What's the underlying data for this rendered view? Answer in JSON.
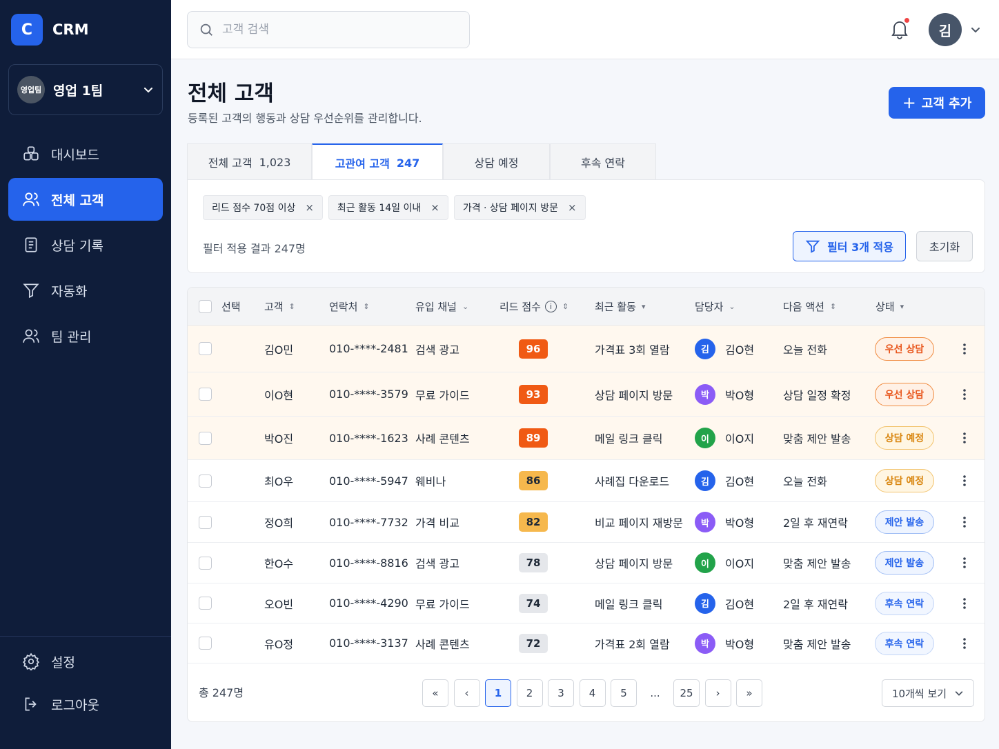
{
  "brand": {
    "logo": "C",
    "name": "CRM"
  },
  "team": {
    "avatar": "영업팀",
    "name": "영업 1팀"
  },
  "nav": [
    {
      "label": "대시보드",
      "icon": "dashboard-icon"
    },
    {
      "label": "전체 고객",
      "icon": "users-icon",
      "active": true
    },
    {
      "label": "상담 기록",
      "icon": "document-icon"
    },
    {
      "label": "자동화",
      "icon": "filter-icon"
    },
    {
      "label": "팀 관리",
      "icon": "team-icon"
    }
  ],
  "nav_bottom": [
    {
      "label": "설정",
      "icon": "gear-icon"
    },
    {
      "label": "로그아웃",
      "icon": "logout-icon"
    }
  ],
  "search": {
    "placeholder": "고객 검색",
    "value": ""
  },
  "user": {
    "avatar": "김"
  },
  "header": {
    "title": "전체 고객",
    "subtitle": "등록된 고객의 행동과 상담 우선순위를 관리합니다.",
    "add_label": "고객 추가"
  },
  "tabs": [
    {
      "label": "전체 고객",
      "count": "1,023",
      "width": 181
    },
    {
      "label": "고관여 고객",
      "count": "247",
      "active": true,
      "width": 190
    },
    {
      "label": "상담 예정",
      "count": "",
      "width": 155
    },
    {
      "label": "후속 연락",
      "count": "",
      "width": 154
    }
  ],
  "filters": {
    "chips": [
      "리드 점수 70점 이상",
      "최근 활동 14일 이내",
      "가격 · 상담 페이지 방문"
    ],
    "result_text": "필터 적용 결과 247명",
    "apply_label": "필터 3개 적용",
    "reset_label": "초기화"
  },
  "table": {
    "columns": {
      "select": "선택",
      "customer": "고객",
      "contact": "연락처",
      "channel": "유입 채널",
      "score": "리드 점수",
      "activity": "최근 활동",
      "owner": "담당자",
      "next": "다음 액션",
      "status": "상태"
    },
    "rows": [
      {
        "customer": "김O민",
        "contact": "010-****-2481",
        "channel": "검색 광고",
        "score": "96",
        "activity": "가격표 3회 열람",
        "owner_init": "김",
        "owner": "김O현",
        "next": "오늘 전화",
        "status": "우선 상담",
        "hot": true
      },
      {
        "customer": "이O현",
        "contact": "010-****-3579",
        "channel": "무료 가이드",
        "score": "93",
        "activity": "상담 페이지 방문",
        "owner_init": "박",
        "owner": "박O형",
        "next": "상담 일정 확정",
        "status": "우선 상담",
        "hot": true
      },
      {
        "customer": "박O진",
        "contact": "010-****-1623",
        "channel": "사례 콘텐츠",
        "score": "89",
        "activity": "메일 링크 클릭",
        "owner_init": "이",
        "owner": "이O지",
        "next": "맞춤 제안 발송",
        "status": "상담 예정",
        "hot": true
      },
      {
        "customer": "최O우",
        "contact": "010-****-5947",
        "channel": "웨비나",
        "score": "86",
        "activity": "사례집 다운로드",
        "owner_init": "김",
        "owner": "김O현",
        "next": "오늘 전화",
        "status": "상담 예정",
        "hot": false
      },
      {
        "customer": "정O희",
        "contact": "010-****-7732",
        "channel": "가격 비교",
        "score": "82",
        "activity": "비교 페이지 재방문",
        "owner_init": "박",
        "owner": "박O형",
        "next": "2일 후 재연락",
        "status": "제안 발송",
        "hot": false
      },
      {
        "customer": "한O수",
        "contact": "010-****-8816",
        "channel": "검색 광고",
        "score": "78",
        "activity": "상담 페이지 방문",
        "owner_init": "이",
        "owner": "이O지",
        "next": "맞춤 제안 발송",
        "status": "제안 발송",
        "hot": false
      },
      {
        "customer": "오O빈",
        "contact": "010-****-4290",
        "channel": "무료 가이드",
        "score": "74",
        "activity": "메일 링크 클릭",
        "owner_init": "김",
        "owner": "김O현",
        "next": "2일 후 재연락",
        "status": "후속 연락",
        "hot": false
      },
      {
        "customer": "유O정",
        "contact": "010-****-3137",
        "channel": "사례 콘텐츠",
        "score": "72",
        "activity": "가격표 2회 열람",
        "owner_init": "박",
        "owner": "박O형",
        "next": "맞춤 제안 발송",
        "status": "후속 연락",
        "hot": false
      }
    ]
  },
  "footer": {
    "total": "총 247명",
    "pages": [
      "«",
      "‹",
      "1",
      "2",
      "3",
      "4",
      "5",
      "...",
      "25",
      "›",
      "»"
    ],
    "active_page": "1",
    "per_page": "10개씩 보기"
  },
  "colors": {
    "accent": "#2563eb",
    "score_high": "#f05a14",
    "score_mid": "#f6b84d",
    "score_low": "#e5e7eb",
    "owner_kim": "#2563eb",
    "owner_park": "#8b5cf6",
    "owner_lee": "#22a34a"
  }
}
